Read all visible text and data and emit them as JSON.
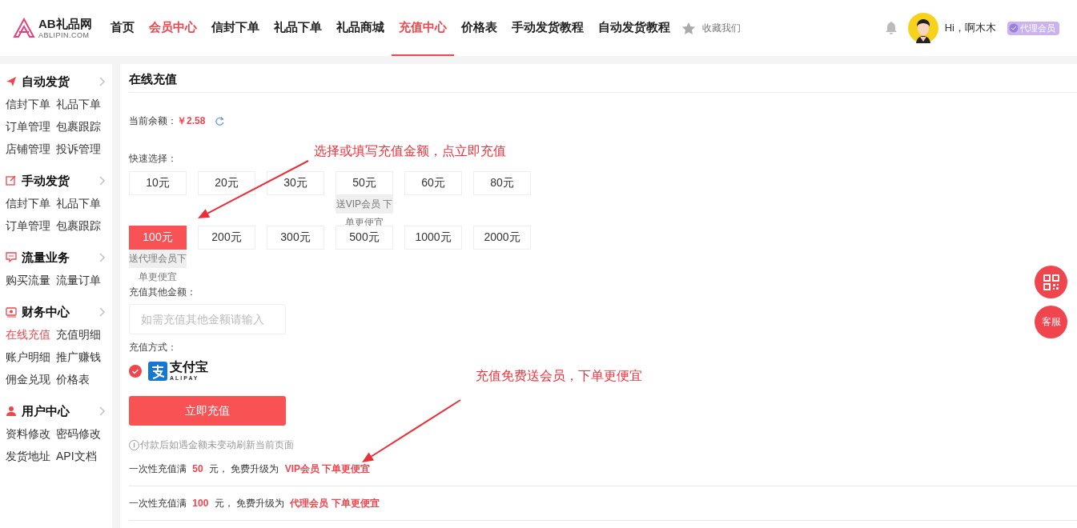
{
  "header": {
    "logo": {
      "title": "AB礼品网",
      "domain": "ABLIPIN.COM"
    },
    "nav": [
      {
        "label": "首页",
        "selected": false,
        "highlight": false
      },
      {
        "label": "会员中心",
        "selected": false,
        "highlight": true
      },
      {
        "label": "信封下单",
        "selected": false,
        "highlight": false
      },
      {
        "label": "礼品下单",
        "selected": false,
        "highlight": false
      },
      {
        "label": "礼品商城",
        "selected": false,
        "highlight": false
      },
      {
        "label": "充值中心",
        "selected": true,
        "highlight": false
      },
      {
        "label": "价格表",
        "selected": false,
        "highlight": false
      },
      {
        "label": "手动发货教程",
        "selected": false,
        "highlight": false
      },
      {
        "label": "自动发货教程",
        "selected": false,
        "highlight": false
      }
    ],
    "favorite": "收藏我们",
    "greeting": "Hi，啊木木",
    "badge": "代理会员"
  },
  "sidebar": [
    {
      "title": "自动发货",
      "links": [
        {
          "label": "信封下单",
          "selected": false
        },
        {
          "label": "礼品下单",
          "selected": false
        },
        {
          "label": "订单管理",
          "selected": false
        },
        {
          "label": "包裹跟踪",
          "selected": false
        },
        {
          "label": "店铺管理",
          "selected": false
        },
        {
          "label": "投诉管理",
          "selected": false
        }
      ]
    },
    {
      "title": "手动发货",
      "links": [
        {
          "label": "信封下单",
          "selected": false
        },
        {
          "label": "礼品下单",
          "selected": false
        },
        {
          "label": "订单管理",
          "selected": false
        },
        {
          "label": "包裹跟踪",
          "selected": false
        }
      ]
    },
    {
      "title": "流量业务",
      "links": [
        {
          "label": "购买流量",
          "selected": false
        },
        {
          "label": "流量订单",
          "selected": false
        }
      ]
    },
    {
      "title": "财务中心",
      "links": [
        {
          "label": "在线充值",
          "selected": true
        },
        {
          "label": "充值明细",
          "selected": false
        },
        {
          "label": "账户明细",
          "selected": false
        },
        {
          "label": "推广赚钱",
          "selected": false
        },
        {
          "label": "佣金兑现",
          "selected": false
        },
        {
          "label": "价格表",
          "selected": false
        }
      ]
    },
    {
      "title": "用户中心",
      "links": [
        {
          "label": "资料修改",
          "selected": false
        },
        {
          "label": "密码修改",
          "selected": false
        },
        {
          "label": "发货地址",
          "selected": false
        },
        {
          "label": "API文档",
          "selected": false
        }
      ]
    }
  ],
  "recharge": {
    "title": "在线充值",
    "balance_label": "当前余额：",
    "balance": "￥2.58",
    "quick_label": "快速选择：",
    "amounts": [
      [
        {
          "label": "10元",
          "selected": false
        },
        {
          "label": "20元",
          "selected": false
        },
        {
          "label": "30元",
          "selected": false
        },
        {
          "label": "50元",
          "selected": false,
          "tag": "送VIP会员 下单更便宜"
        },
        {
          "label": "60元",
          "selected": false
        },
        {
          "label": "80元",
          "selected": false
        }
      ],
      [
        {
          "label": "100元",
          "selected": true,
          "tag": "送代理会员下单更便宜"
        },
        {
          "label": "200元",
          "selected": false
        },
        {
          "label": "300元",
          "selected": false
        },
        {
          "label": "500元",
          "selected": false
        },
        {
          "label": "1000元",
          "selected": false
        },
        {
          "label": "2000元",
          "selected": false
        }
      ]
    ],
    "other_label": "充值其他金额：",
    "other_placeholder": "如需充值其他金额请输入",
    "method_label": "充值方式：",
    "method": {
      "checked": true,
      "name": "支付宝",
      "sub": "ALIPAY"
    },
    "submit": "立即充值",
    "tip": "付款后如遇金额未变动刷新当前页面",
    "offers": [
      "一次性充值满 **50** 元， 免费升级为 **VIP会员 下单更便宜**",
      "一次性充值满 **100** 元， 免费升级为 **代理会员 下单更便宜**"
    ]
  },
  "annotations": [
    "选择或填写充值金额，点立即充值",
    "充值免费送会员，下单更便宜"
  ],
  "float_buttons": [
    {
      "kind": "qr"
    },
    {
      "kind": "text",
      "label": "客服"
    }
  ]
}
